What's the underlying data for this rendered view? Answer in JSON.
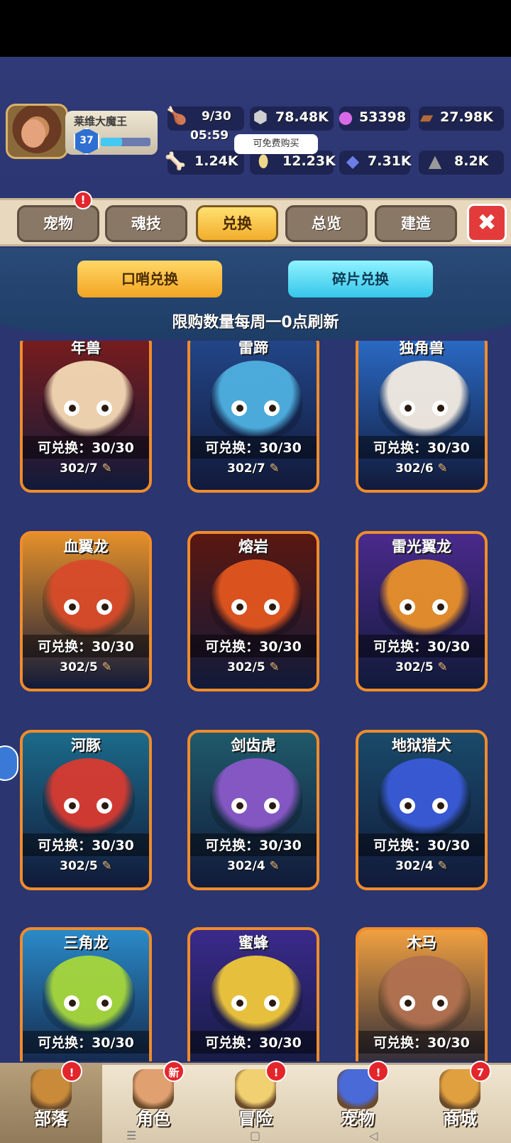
{
  "player": {
    "name": "莱维大魔王",
    "level": "37",
    "xp_fraction": 0.43
  },
  "resources": {
    "stamina": "9/30",
    "stamina_timer": "05:59",
    "stone": "78.48K",
    "gem": "53398",
    "wood": "27.98K",
    "bone": "1.24K",
    "coin": "12.23K",
    "crystal": "7.31K",
    "ore": "8.2K"
  },
  "tooltip": "可免费购买",
  "tabs": [
    {
      "label": "宠物",
      "badge": "!"
    },
    {
      "label": "魂技"
    },
    {
      "label": "兑换",
      "active": true
    },
    {
      "label": "总览"
    },
    {
      "label": "建造"
    }
  ],
  "close_label": "✖",
  "subtabs": {
    "whistle": "口哨兑换",
    "fragment": "碎片兑换"
  },
  "refresh_note": "限购数量每周一0点刷新",
  "cards": [
    {
      "name": "年兽",
      "exchange": "可兑换：30/30",
      "cost": "302/7",
      "bg": "#7a1c1c",
      "body": "#f4d9b5"
    },
    {
      "name": "雷蹄",
      "exchange": "可兑换：30/30",
      "cost": "302/7",
      "bg": "#23478a",
      "body": "#4fb0e0"
    },
    {
      "name": "独角兽",
      "exchange": "可兑换：30/30",
      "cost": "302/6",
      "bg": "#2b6cc8",
      "body": "#f3ebe0"
    },
    {
      "name": "血翼龙",
      "exchange": "可兑换：30/30",
      "cost": "302/5",
      "bg": "#e38f2a",
      "body": "#d84a2a"
    },
    {
      "name": "熔岩",
      "exchange": "可兑换：30/30",
      "cost": "302/5",
      "bg": "#5a1710",
      "body": "#e2561f"
    },
    {
      "name": "雷光翼龙",
      "exchange": "可兑换：30/30",
      "cost": "302/5",
      "bg": "#4a2a8c",
      "body": "#e8902a"
    },
    {
      "name": "河豚",
      "exchange": "可兑换：30/30",
      "cost": "302/5",
      "bg": "#1c6a8a",
      "body": "#d83a30"
    },
    {
      "name": "剑齿虎",
      "exchange": "可兑换：30/30",
      "cost": "302/4",
      "bg": "#1f5a6a",
      "body": "#8a58c8"
    },
    {
      "name": "地狱猎犬",
      "exchange": "可兑换：30/30",
      "cost": "302/4",
      "bg": "#1a4a6a",
      "body": "#3a5ad8"
    },
    {
      "name": "三角龙",
      "exchange": "可兑换：30/30",
      "cost": "",
      "bg": "#2a8ac8",
      "body": "#a6d63a"
    },
    {
      "name": "蜜蜂",
      "exchange": "可兑换：30/30",
      "cost": "",
      "bg": "#3a2a8a",
      "body": "#f0c83a"
    },
    {
      "name": "木马",
      "exchange": "可兑换：30/30",
      "cost": "",
      "bg": "#f0a040",
      "body": "#b07050"
    }
  ],
  "bottom_nav": [
    {
      "label": "部落",
      "badge": "!",
      "active": true
    },
    {
      "label": "角色",
      "badge": "新"
    },
    {
      "label": "冒险",
      "badge": "!"
    },
    {
      "label": "宠物",
      "badge": "!"
    },
    {
      "label": "商城",
      "badge": "7"
    }
  ]
}
